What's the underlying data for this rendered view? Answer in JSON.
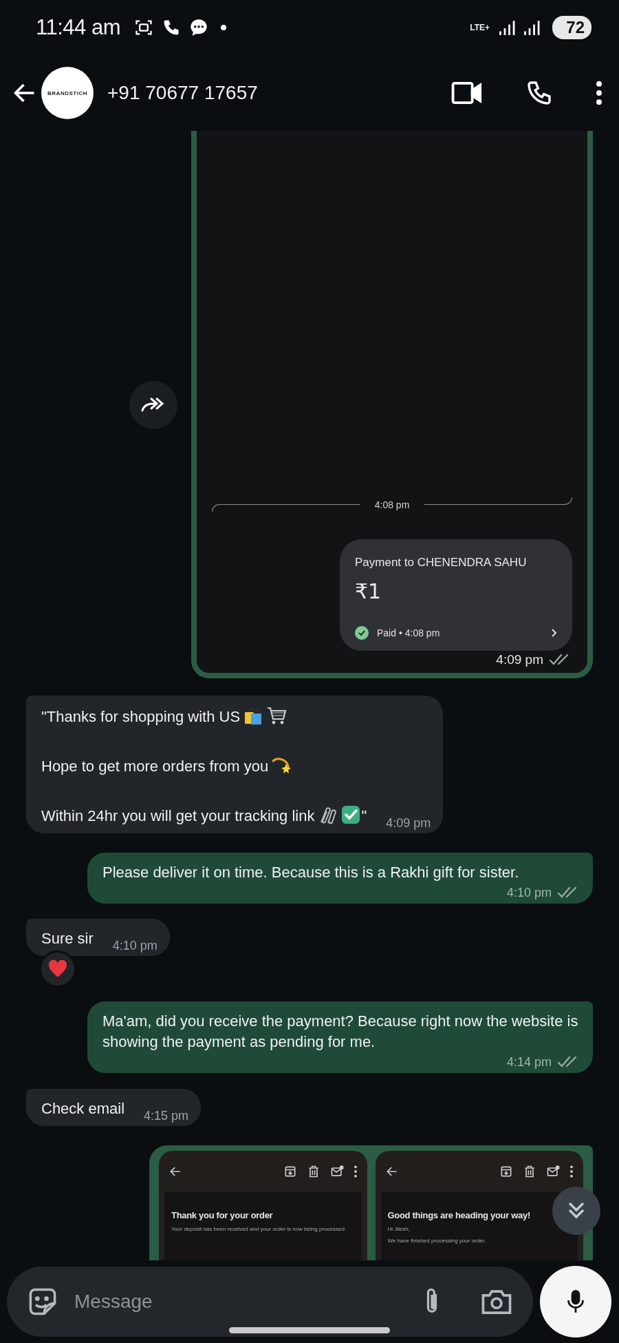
{
  "status_bar": {
    "time": "11:44 am",
    "network": "LTE+",
    "battery": "72"
  },
  "header": {
    "avatar_text": "BRANDSTICH",
    "contact": "+91 70677 17657"
  },
  "messages": [
    {
      "kind": "image",
      "outgoing": true,
      "delivered": true,
      "time": "4:09 pm",
      "content": {
        "divider_time": "4:08 pm",
        "title": "Payment to CHENENDRA SAHU",
        "amount": "₹1",
        "payment_status": "Paid • 4:08 pm"
      }
    },
    {
      "kind": "text",
      "outgoing": false,
      "time": "4:09 pm",
      "lines": [
        {
          "text": "\"Thanks for shopping with US",
          "emoji": [
            {
              "kind": "bags"
            },
            {
              "kind": "cart"
            }
          ]
        },
        {
          "text": "Hope to get more orders from you",
          "emoji": [
            {
              "kind": "comet"
            }
          ]
        },
        {
          "text": "Within 24hr you will get your tracking link",
          "emoji": [
            {
              "kind": "paperclips"
            },
            {
              "kind": "checkbox"
            }
          ],
          "after": "\""
        }
      ]
    },
    {
      "kind": "text",
      "outgoing": true,
      "delivered": true,
      "time": "4:10 pm",
      "lines": [
        {
          "text": "Please deliver it on time. Because this is a Rakhi gift for sister."
        }
      ]
    },
    {
      "kind": "text",
      "outgoing": false,
      "time": "4:10 pm",
      "reaction": {
        "kind": "heart"
      },
      "lines": [
        {
          "text": "Sure sir"
        }
      ]
    },
    {
      "kind": "text",
      "outgoing": true,
      "delivered": true,
      "time": "4:14 pm",
      "lines": [
        {
          "text": "Ma'am, did you receive the payment? Because right now the website is showing the payment as pending for me."
        }
      ]
    },
    {
      "kind": "text",
      "outgoing": false,
      "time": "4:15 pm",
      "lines": [
        {
          "text": "Check email"
        }
      ]
    },
    {
      "kind": "emails",
      "outgoing": true,
      "shots": [
        {
          "heading": "Thank you for your order",
          "lines": [
            "Your deposit has been received and your order is now being processed"
          ]
        },
        {
          "heading": "Good things are heading your way!",
          "lines": [
            "Hi Jilesh,",
            "We have finished processing your order."
          ]
        }
      ]
    }
  ],
  "composer": {
    "placeholder": "Message"
  }
}
